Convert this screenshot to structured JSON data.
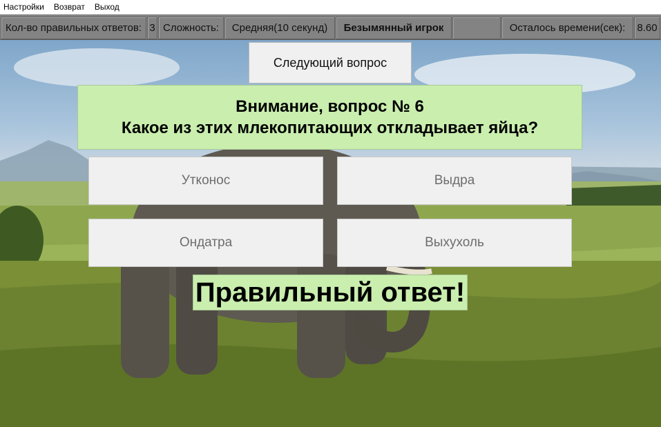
{
  "menu": {
    "items": [
      {
        "label": "Настройки"
      },
      {
        "label": "Возврат"
      },
      {
        "label": "Выход"
      }
    ]
  },
  "status": {
    "correct_label": "Кол-во правильных ответов:",
    "correct_value": "3",
    "difficulty_label": "Сложность:",
    "difficulty_value": "Средняя(10 секунд)",
    "player_name": "Безымянный игрок",
    "time_label": "Осталось времени(сек):",
    "time_value": "8.60"
  },
  "next_button": {
    "label": "Следующий вопрос"
  },
  "question": {
    "heading": "Внимание, вопрос № 6",
    "text": "Какое из этих млекопитающих откладывает яйца?"
  },
  "answers": [
    {
      "label": "Утконос"
    },
    {
      "label": "Выдра"
    },
    {
      "label": "Ондатра"
    },
    {
      "label": "Выхухоль"
    }
  ],
  "result": {
    "text": "Правильный ответ!"
  },
  "colors": {
    "panel_green": "#c9eeae",
    "status_gray": "#838383",
    "button_gray": "#f0f0f0"
  }
}
